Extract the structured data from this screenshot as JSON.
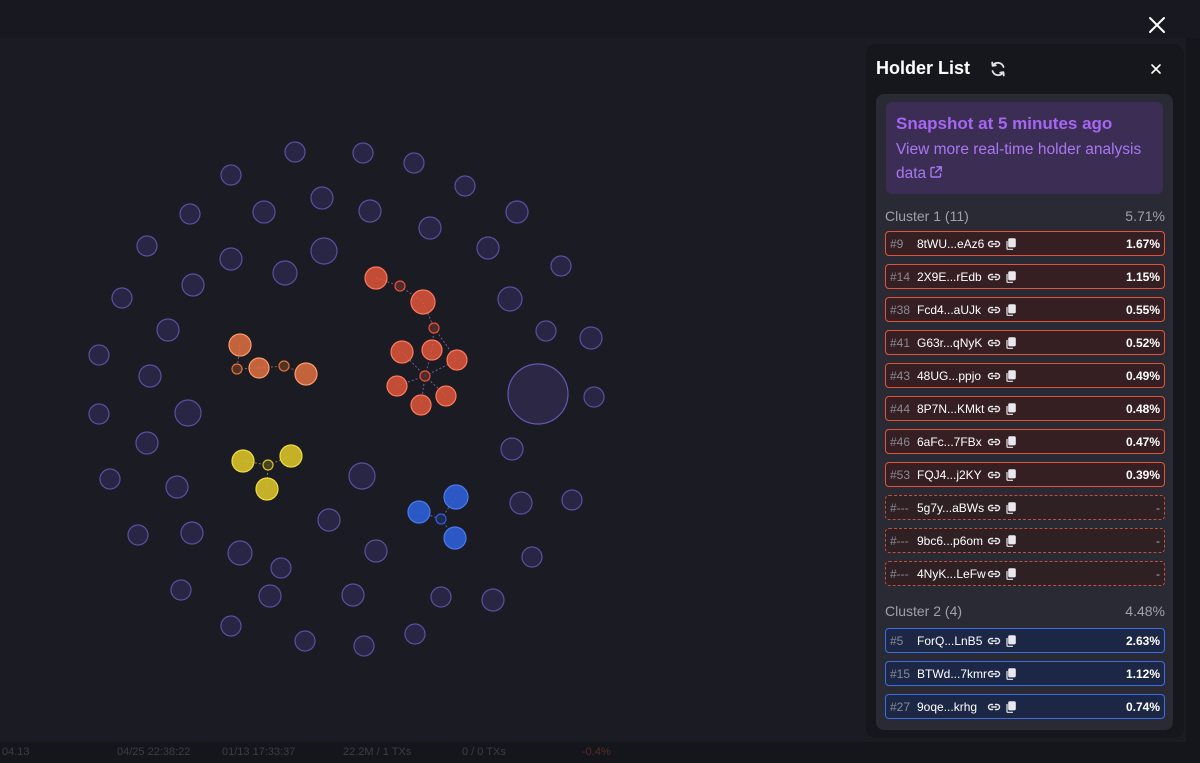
{
  "panel": {
    "title": "Holder List",
    "snapshot_title": "Snapshot at 5 minutes ago",
    "snapshot_link": "View more real-time holder analysis data"
  },
  "clusters": [
    {
      "label": "Cluster 1 (11)",
      "total": "5.71%",
      "color": "#e0553a",
      "rows": [
        {
          "rank": "#9",
          "addr": "8tWU...eAz6",
          "pct": "1.67%",
          "dashed": false
        },
        {
          "rank": "#14",
          "addr": "2X9E...rEdb",
          "pct": "1.15%",
          "dashed": false
        },
        {
          "rank": "#38",
          "addr": "Fcd4...aUJk",
          "pct": "0.55%",
          "dashed": false
        },
        {
          "rank": "#41",
          "addr": "G63r...qNyK",
          "pct": "0.52%",
          "dashed": false
        },
        {
          "rank": "#43",
          "addr": "48UG...ppjo",
          "pct": "0.49%",
          "dashed": false
        },
        {
          "rank": "#44",
          "addr": "8P7N...KMkt",
          "pct": "0.48%",
          "dashed": false
        },
        {
          "rank": "#46",
          "addr": "6aFc...7FBx",
          "pct": "0.47%",
          "dashed": false
        },
        {
          "rank": "#53",
          "addr": "FQJ4...j2KY",
          "pct": "0.39%",
          "dashed": false
        },
        {
          "rank": "#---",
          "addr": "5g7y...aBWs",
          "pct": "-",
          "dashed": true
        },
        {
          "rank": "#---",
          "addr": "9bc6...p6om",
          "pct": "-",
          "dashed": true
        },
        {
          "rank": "#---",
          "addr": "4NyK...LeFw",
          "pct": "-",
          "dashed": true
        }
      ]
    },
    {
      "label": "Cluster 2 (4)",
      "total": "4.48%",
      "color": "#3b6ee6",
      "rows": [
        {
          "rank": "#5",
          "addr": "ForQ...LnB5",
          "pct": "2.63%",
          "dashed": false
        },
        {
          "rank": "#15",
          "addr": "BTWd...7kmr",
          "pct": "1.12%",
          "dashed": false
        },
        {
          "rank": "#27",
          "addr": "9oqe...krhg",
          "pct": "0.74%",
          "dashed": false
        }
      ]
    }
  ],
  "background_strip": [
    "04.13",
    "04/25 22:38:22",
    "01/13 17:33:37",
    "22.2M / 1 TXs",
    "0 / 0 TXs",
    "-0.4%"
  ],
  "colors": {
    "background": "#1b1b24",
    "node_default": "#6a5fb0",
    "cluster_red": "#e0553a",
    "cluster_orange": "#e07040",
    "cluster_yellow": "#d8c228",
    "cluster_blue": "#2f5fd8",
    "accent_purple": "#a566f2"
  },
  "icons": {
    "close": "close-icon",
    "refresh": "refresh-icon",
    "external": "external-link-icon",
    "link": "link-icon",
    "copy": "copy-icon"
  }
}
